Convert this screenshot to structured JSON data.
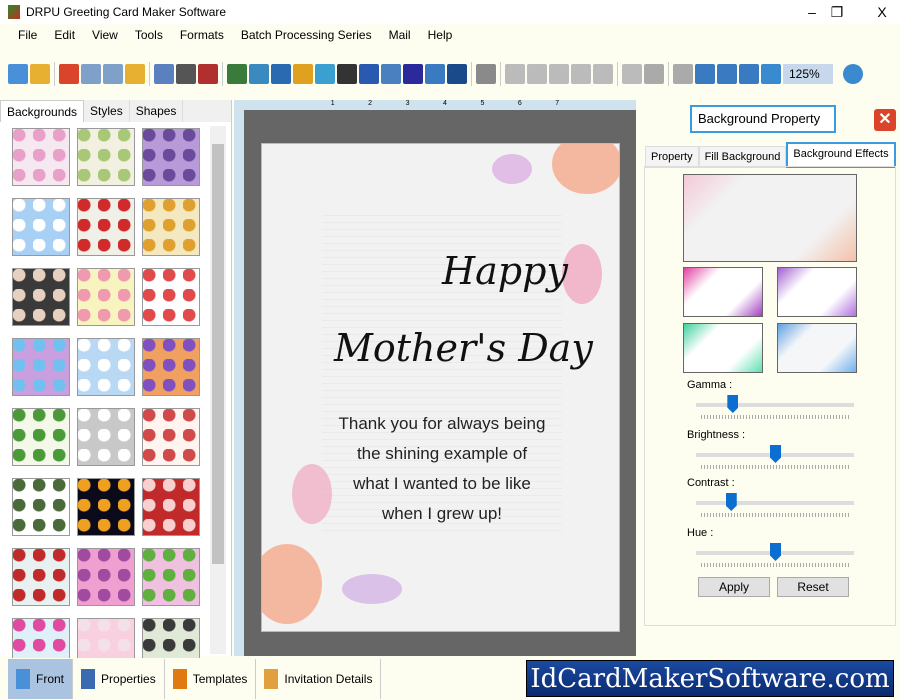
{
  "window": {
    "title": "DRPU Greeting Card Maker Software",
    "minimize": "–",
    "restore": "❐",
    "close": "X"
  },
  "menu": [
    "File",
    "Edit",
    "View",
    "Tools",
    "Formats",
    "Batch Processing Series",
    "Mail",
    "Help"
  ],
  "toolbar": {
    "icons": [
      [
        "new-icon",
        "#4a90d9"
      ],
      [
        "open-icon",
        "#e8b030"
      ],
      [
        "close-doc-icon",
        "#d9442a"
      ],
      [
        "save-icon",
        "#7fa0c8"
      ],
      [
        "save-as-icon",
        "#7fa0c8"
      ],
      [
        "export-icon",
        "#e8b030"
      ],
      [
        "properties-icon",
        "#5a80c0"
      ],
      [
        "print-icon",
        "#555"
      ],
      [
        "print-batch-icon",
        "#b03030"
      ],
      [
        "background-icon",
        "#3a7a3a"
      ],
      [
        "image-icon",
        "#3a8ac0"
      ],
      [
        "pen-icon",
        "#2a6ab0"
      ],
      [
        "shape-icon",
        "#e0a020"
      ],
      [
        "text-wave-icon",
        "#3aa0d0"
      ],
      [
        "barcode-icon",
        "#333"
      ],
      [
        "text-icon",
        "#2a5ab0"
      ],
      [
        "word-art-icon",
        "#4a80c0"
      ],
      [
        "signature-icon",
        "#2a2a9a"
      ],
      [
        "mail-icon",
        "#3a7ac0"
      ],
      [
        "line-icon",
        "#1a4a8a"
      ],
      [
        "database-icon",
        "#8a8a8a"
      ],
      [
        "undo-icon",
        "#bbb"
      ],
      [
        "redo-icon",
        "#bbb"
      ],
      [
        "cut-icon",
        "#bbb"
      ],
      [
        "copy-icon",
        "#bbb"
      ],
      [
        "paste-icon",
        "#bbb"
      ],
      [
        "delete-icon",
        "#bbb"
      ],
      [
        "bring-front-icon",
        "#aaa"
      ],
      [
        "send-back-icon",
        "#aaa"
      ],
      [
        "grid-icon",
        "#3a7ac0"
      ],
      [
        "actual-size-icon",
        "#3a7ac0"
      ],
      [
        "fit-icon",
        "#3a7ac0"
      ],
      [
        "zoom-in-icon",
        "#3a8ad0"
      ]
    ],
    "zoom": "125%",
    "zoom_out_icon": "zoom-out-icon"
  },
  "left_panel": {
    "tabs": [
      "Backgrounds",
      "Styles",
      "Shapes"
    ],
    "active_tab": "Backgrounds",
    "thumbnails": [
      [
        "#f6e8f0",
        "#e9a0c8"
      ],
      [
        "#f2f0e0",
        "#a8c878"
      ],
      [
        "#b89ad8",
        "#6a4a9a"
      ],
      [
        "#a8d0f4",
        "#ffffff"
      ],
      [
        "#f0f0e8",
        "#d02a2a"
      ],
      [
        "#f4e8c0",
        "#e0a030"
      ],
      [
        "#3a3a3a",
        "#e8d0c0"
      ],
      [
        "#f8f4c0",
        "#f09ab0"
      ],
      [
        "#fff",
        "#e04a4a"
      ],
      [
        "#c8a0e0",
        "#70c0f0"
      ],
      [
        "#b8d8f4",
        "#ffffff"
      ],
      [
        "#f0a060",
        "#8050c0"
      ],
      [
        "#f4f8e8",
        "#4a9a3a"
      ],
      [
        "#c8c8c8",
        "#ffffff"
      ],
      [
        "#fff4f0",
        "#d04a4a"
      ],
      [
        "#ffffff",
        "#4a6a3a"
      ],
      [
        "#0a0a1a",
        "#f0a020"
      ],
      [
        "#c02a2a",
        "#f8d0d0"
      ],
      [
        "#e8f0f0",
        "#c02a2a"
      ],
      [
        "#f0a0d0",
        "#a04aa0"
      ],
      [
        "#f0c0e0",
        "#60b040"
      ],
      [
        "#e0f0f8",
        "#e04aa0"
      ],
      [
        "#f8d0e0",
        "#f4e0ea"
      ],
      [
        "#e0e8d8",
        "#3a3a3a"
      ]
    ]
  },
  "ruler_marks": [
    "1",
    "2",
    "3",
    "4",
    "5",
    "6",
    "7"
  ],
  "card": {
    "line1": "Happy",
    "line2": "Mother's Day",
    "message": [
      "Thank you for always being",
      "the shining example of",
      "what I wanted to be like",
      "when I grew up!"
    ]
  },
  "right_panel": {
    "title": "Background Property",
    "close_icon": "close-icon",
    "tabs": [
      "Property",
      "Fill Background",
      "Background Effects"
    ],
    "active_tab": "Background Effects",
    "sliders": [
      {
        "label": "Gamma :",
        "value": 0.23
      },
      {
        "label": "Brightness :",
        "value": 0.5
      },
      {
        "label": "Contrast :",
        "value": 0.22
      },
      {
        "label": "Hue :",
        "value": 0.5
      }
    ],
    "apply": "Apply",
    "reset": "Reset"
  },
  "bottom": {
    "tabs": [
      "Front",
      "Properties",
      "Templates",
      "Invitation Details"
    ],
    "active": "Front",
    "brand": "IdCardMakerSoftware.com"
  }
}
